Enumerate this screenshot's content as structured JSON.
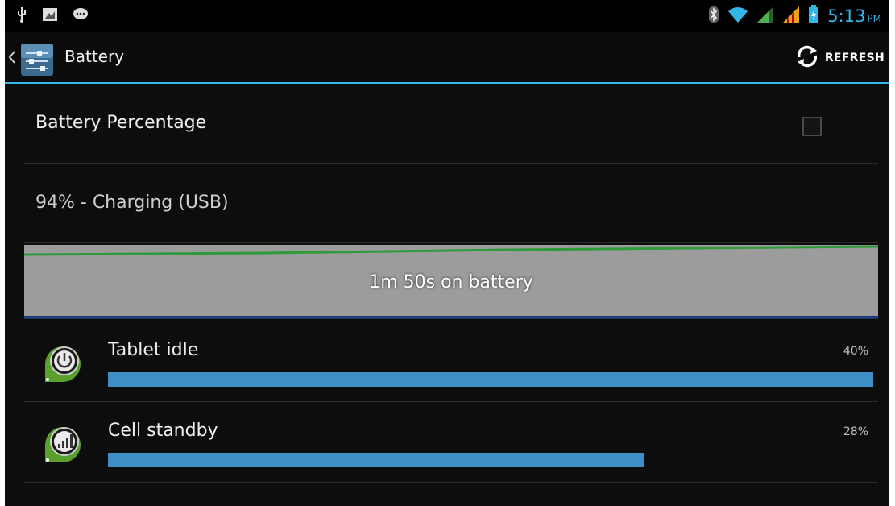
{
  "status_bar": {
    "left_icons": [
      "usb-icon",
      "screenshot-icon",
      "chat-icon"
    ],
    "right_icons": [
      "bluetooth-icon",
      "wifi-icon",
      "signal-icon",
      "signal-icon-2",
      "battery-icon"
    ],
    "time": "5:13",
    "ampm": "PM"
  },
  "action_bar": {
    "title": "Battery",
    "refresh_label": "REFRESH"
  },
  "battery_percentage": {
    "label": "Battery Percentage",
    "checked": false
  },
  "status": {
    "text": "94% - Charging (USB)"
  },
  "history": {
    "label": "1m 50s on battery"
  },
  "usage": [
    {
      "name": "Tablet idle",
      "percent_label": "40%",
      "fill_fraction": 1.0,
      "icon": "power-icon"
    },
    {
      "name": "Cell standby",
      "percent_label": "28%",
      "fill_fraction": 0.7,
      "icon": "cell-signal-icon"
    }
  ],
  "colors": {
    "accent": "#33b5e5",
    "usage_bar": "#3d8fc6",
    "history_bg": "#9c9c9c",
    "history_line": "#2e9a3a"
  }
}
